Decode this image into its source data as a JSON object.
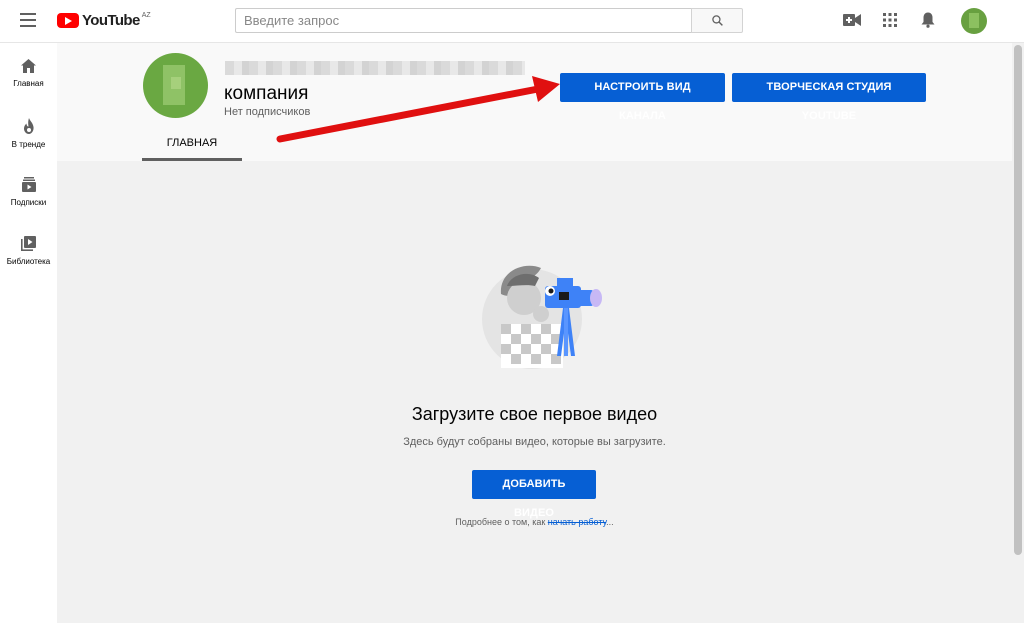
{
  "topbar": {
    "logo_text": "YouTube",
    "logo_country": "AZ",
    "search_placeholder": "Введите запрос"
  },
  "sidebar": {
    "items": [
      {
        "label": "Главная",
        "icon": "home-icon"
      },
      {
        "label": "В тренде",
        "icon": "trending-icon"
      },
      {
        "label": "Подписки",
        "icon": "subscriptions-icon"
      },
      {
        "label": "Библиотека",
        "icon": "library-icon"
      }
    ]
  },
  "channel": {
    "name": "компания",
    "subscribers": "Нет подписчиков",
    "customize_label": "НАСТРОИТЬ ВИД КАНАЛА",
    "studio_label": "ТВОРЧЕСКАЯ СТУДИЯ YOUTUBE",
    "tabs": [
      {
        "label": "ГЛАВНАЯ",
        "active": true
      }
    ]
  },
  "empty_state": {
    "title": "Загрузите свое первое видео",
    "subtitle": "Здесь будут собраны видео, которые вы загрузите.",
    "add_button": "ДОБАВИТЬ ВИДЕО",
    "learn_prefix": "Подробнее о том, как ",
    "learn_link": "начать работу",
    "learn_suffix": "..."
  },
  "colors": {
    "accent": "#065fd4",
    "brand_red": "#ff0000",
    "annotation_arrow": "#e01010"
  }
}
